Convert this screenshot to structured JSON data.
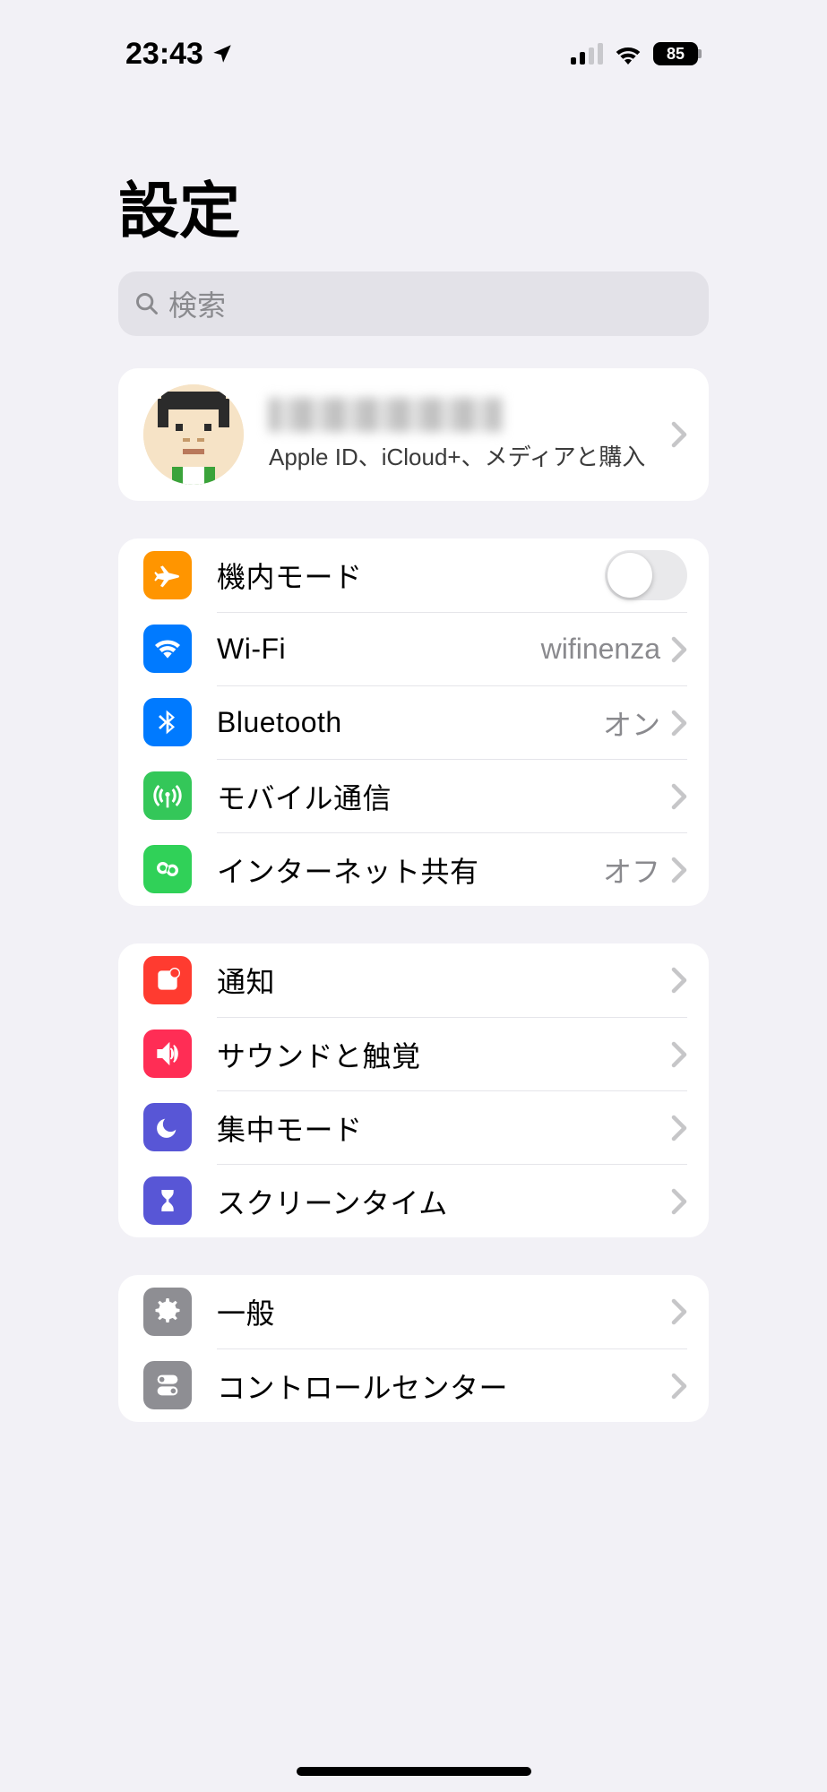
{
  "status": {
    "time": "23:43",
    "battery": "85"
  },
  "title": "設定",
  "search": {
    "placeholder": "検索"
  },
  "profile": {
    "subtitle": "Apple ID、iCloud+、メディアと購入"
  },
  "g1": {
    "airplane": "機内モード",
    "wifi": "Wi-Fi",
    "wifi_value": "wifinenza",
    "bluetooth": "Bluetooth",
    "bluetooth_value": "オン",
    "cellular": "モバイル通信",
    "hotspot": "インターネット共有",
    "hotspot_value": "オフ"
  },
  "g2": {
    "notifications": "通知",
    "sounds": "サウンドと触覚",
    "focus": "集中モード",
    "screentime": "スクリーンタイム"
  },
  "g3": {
    "general": "一般",
    "controlcenter": "コントロールセンター"
  }
}
